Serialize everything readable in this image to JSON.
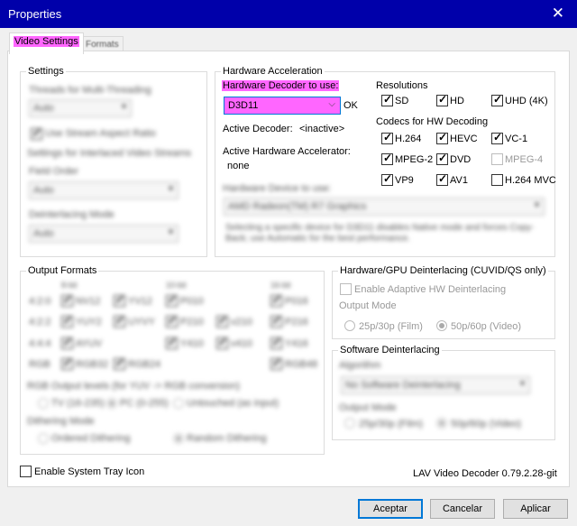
{
  "window": {
    "title": "Properties",
    "close_glyph": "✕"
  },
  "tabs": [
    {
      "label": "Video Settings"
    },
    {
      "label": "Formats"
    }
  ],
  "settings": {
    "legend": "Settings",
    "threads_label": "Threads for Multi-Threading",
    "threads_value": "Auto",
    "stream_ar_label": "Use Stream Aspect Ratio",
    "interlaced_label": "Settings for Interlaced Video Streams",
    "field_order_label": "Field Order",
    "field_order_value": "Auto",
    "deint_mode_label": "Deinterlacing Mode",
    "deint_mode_value": "Auto"
  },
  "hwaccel": {
    "legend": "Hardware Acceleration",
    "decoder_label": "Hardware Decoder to use:",
    "decoder_value": "D3D11",
    "decoder_status": "OK",
    "active_decoder_label": "Active Decoder:",
    "active_decoder_value": "<inactive>",
    "active_accel_label": "Active Hardware Accelerator:",
    "active_accel_value": "none",
    "device_label": "Hardware Device to use:",
    "device_value": "AMD Radeon(TM) R7 Graphics",
    "device_help": "Selecting a specific device for D3D11 disables Native mode and forces Copy-Back; use Automatic for the best performance.",
    "resolutions_label": "Resolutions",
    "resolutions": [
      {
        "label": "SD",
        "checked": true
      },
      {
        "label": "HD",
        "checked": true
      },
      {
        "label": "UHD (4K)",
        "checked": true
      }
    ],
    "codecs_label": "Codecs for HW Decoding",
    "codecs": [
      {
        "label": "H.264",
        "checked": true,
        "enabled": true
      },
      {
        "label": "HEVC",
        "checked": true,
        "enabled": true
      },
      {
        "label": "VC-1",
        "checked": true,
        "enabled": true
      },
      {
        "label": "MPEG-2",
        "checked": true,
        "enabled": true
      },
      {
        "label": "DVD",
        "checked": true,
        "enabled": true
      },
      {
        "label": "MPEG-4",
        "checked": false,
        "enabled": false
      },
      {
        "label": "VP9",
        "checked": true,
        "enabled": true
      },
      {
        "label": "AV1",
        "checked": true,
        "enabled": true
      },
      {
        "label": "H.264 MVC",
        "checked": false,
        "enabled": true
      }
    ]
  },
  "output_formats": {
    "legend": "Output Formats",
    "bit8": "8-bit",
    "bit10": "10-bit",
    "bit16": "16-bit",
    "rows": [
      "4:2:0",
      "4:2:2",
      "4:4:4",
      "RGB"
    ],
    "formats": [
      "NV12",
      "YV12",
      "P010",
      "P016",
      "YUY2",
      "UYVY",
      "P210",
      "v210",
      "P216",
      "AYUV",
      "Y410",
      "v410",
      "Y416",
      "RGB32",
      "RGB24",
      "RGB48"
    ],
    "rgb_levels_label": "RGB Output levels (for YUV -> RGB conversion)",
    "rgb_levels": [
      "TV (16-235)",
      "PC (0-255)",
      "Untouched (as input)"
    ],
    "dither_label": "Dithering Mode",
    "dither_options": [
      "Ordered Dithering",
      "Random Dithering"
    ]
  },
  "hw_deint": {
    "legend": "Hardware/GPU Deinterlacing (CUVID/QS only)",
    "enable_label": "Enable Adaptive HW Deinterlacing",
    "output_mode_label": "Output Mode",
    "mode_film": "25p/30p (Film)",
    "mode_video": "50p/60p (Video)"
  },
  "sw_deint": {
    "legend": "Software Deinterlacing",
    "algorithm_label": "Algorithm",
    "algorithm_value": "No Software Deinterlacing",
    "output_mode_label": "Output Mode",
    "mode_film": "25p/30p (Film)",
    "mode_video": "50p/60p (Video)"
  },
  "footer": {
    "tray_label": "Enable System Tray Icon",
    "version": "LAV Video Decoder 0.79.2.28-git"
  },
  "buttons": {
    "accept": "Aceptar",
    "cancel": "Cancelar",
    "apply": "Aplicar"
  }
}
